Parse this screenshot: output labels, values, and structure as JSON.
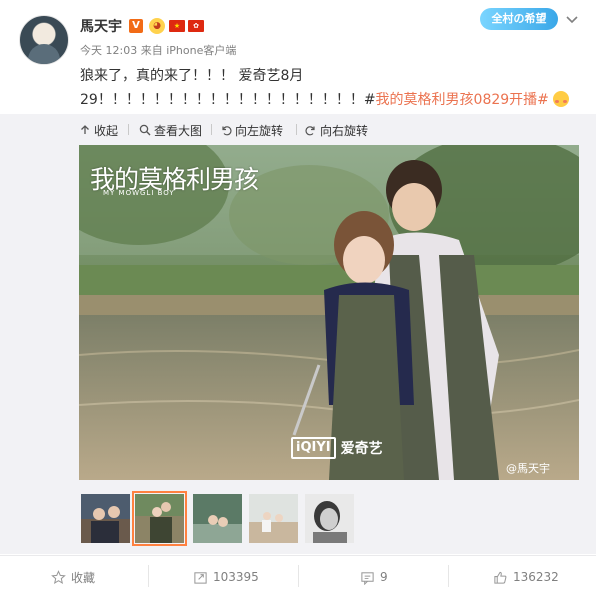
{
  "post": {
    "username": "馬天宇",
    "verified_badge": "V",
    "emoji_badge": "emoji-face-icon",
    "flags": [
      "china-flag-icon",
      "hong-kong-flag-icon"
    ],
    "time": "今天 12:03",
    "from_prefix": "来自",
    "source": "iPhone客户端",
    "text_plain": "狼来了，真的来了！！！ 爱奇艺8月29！！！！！！！！！！！！！！！！！！！#",
    "topic": "我的莫格利男孩0829开播#",
    "end_emoji": "blush-emoji-icon"
  },
  "header": {
    "badge_label": "全村の希望",
    "menu_icon": "chevron-down-icon"
  },
  "toolbar": {
    "collapse": "收起",
    "view_large": "查看大图",
    "rotate_left": "向左旋转",
    "rotate_right": "向右旋转"
  },
  "photo": {
    "title": "我的莫格利男孩",
    "subtitle": "MY MOWGLI BOY",
    "logo_box": "iQIYI",
    "logo_text": "爱奇艺",
    "watermark": "@馬天宇"
  },
  "thumbnails": [
    "thumb-1",
    "thumb-2",
    "thumb-3",
    "thumb-4",
    "thumb-5"
  ],
  "selected_thumbnail": 2,
  "actions": {
    "favorite": "收藏",
    "repost": "103395",
    "comment": "9",
    "like": "136232"
  },
  "colors": {
    "topic_link": "#eb7350",
    "verified": "#f26b16",
    "selected_outline": "#ff8140",
    "panel_bg": "#f2f2f5"
  }
}
